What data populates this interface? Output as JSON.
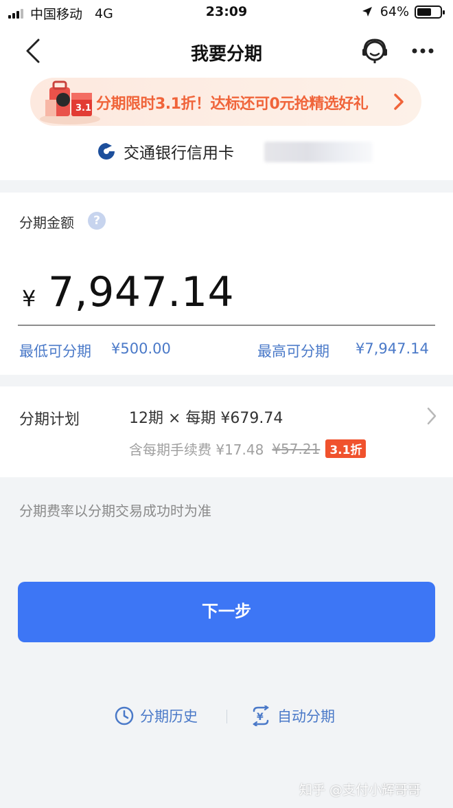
{
  "status_bar": {
    "carrier": "中国移动",
    "network": "4G",
    "time": "23:09",
    "battery": "64%",
    "battery_level": 0.64
  },
  "nav": {
    "title": "我要分期",
    "back_icon": "chevron-left-icon",
    "service_icon": "customer-service-icon",
    "more_icon": "more-dots-icon"
  },
  "promo": {
    "text": "分期限时3.1折！达标还可0元抢精选好礼",
    "badge_text": "3.1",
    "accent_color": "#f0643a"
  },
  "card": {
    "bank_name": "交通银行信用卡"
  },
  "amount": {
    "label": "分期金额",
    "help": "?",
    "currency": "¥",
    "value": "7,947.14",
    "min_label": "最低可分期",
    "min_value": "¥500.00",
    "max_label": "最高可分期",
    "max_value": "¥7,947.14"
  },
  "plan": {
    "label": "分期计划",
    "main": "12期 × 每期 ¥679.74",
    "fee_label": "含每期手续费 ¥17.48",
    "fee_original": "¥57.21",
    "discount": "3.1折"
  },
  "note": "分期费率以分期交易成功时为准",
  "next_button": "下一步",
  "links": {
    "history": "分期历史",
    "auto": "自动分期"
  },
  "watermark": "知乎 @支付小辉哥哥",
  "colors": {
    "primary": "#3d76f5",
    "link": "#4a79c8",
    "discount": "#f0522d"
  }
}
